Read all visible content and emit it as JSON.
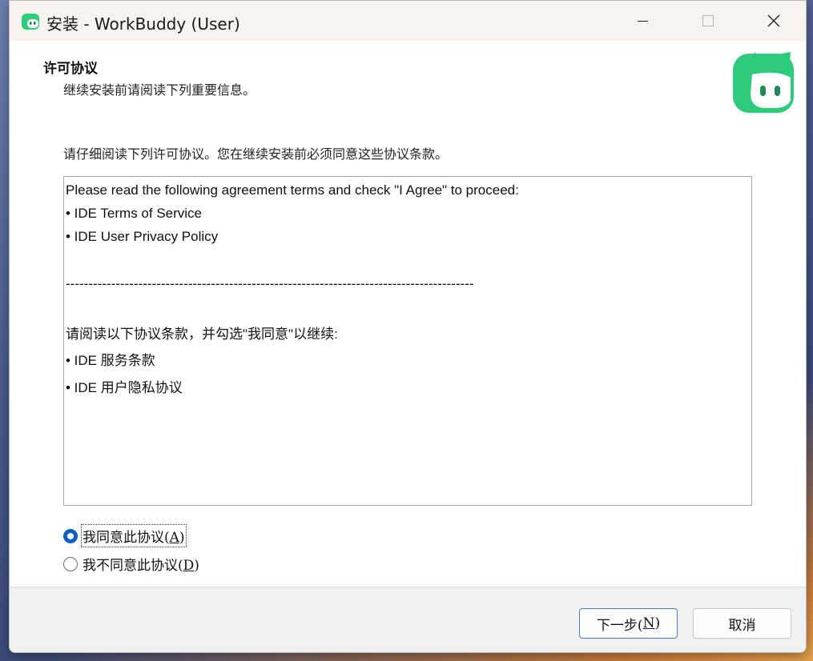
{
  "window": {
    "title": "安装 - WorkBuddy (User)"
  },
  "header": {
    "heading": "许可协议",
    "subheading": "继续安装前请阅读下列重要信息。"
  },
  "instruction": "请仔细阅读下列许可协议。您在继续安装前必须同意这些协议条款。",
  "license_lines": [
    "Please read the following agreement terms and check \"I Agree\" to proceed:",
    "• IDE Terms of Service",
    "• IDE User Privacy Policy",
    "------------------------------------------------------------------------------------------",
    "请阅读以下协议条款，并勾选\"我同意\"以继续:",
    "• IDE 服务条款",
    "• IDE 用户隐私协议"
  ],
  "options": {
    "agree": {
      "text": "我同意此协议(",
      "key": "A",
      "close": ")",
      "selected": true
    },
    "disagree": {
      "text": "我不同意此协议(",
      "key": "D",
      "close": ")",
      "selected": false
    }
  },
  "buttons": {
    "next": {
      "text": "下一步(",
      "key": "N",
      "close": ")"
    },
    "cancel": "取消"
  },
  "colors": {
    "accent": "#0a5fbf",
    "brand_green": "#2ecb7a"
  },
  "icons": {
    "app": "workbuddy-logo-icon",
    "minimize": "minimize-icon",
    "maximize": "maximize-icon",
    "close": "close-icon"
  }
}
